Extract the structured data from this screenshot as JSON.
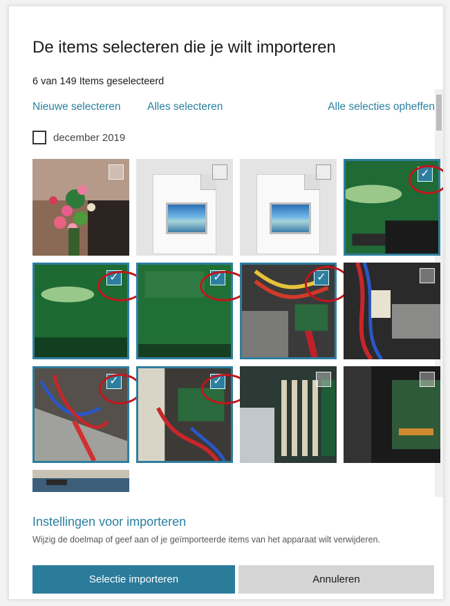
{
  "dialog": {
    "title": "De items selecteren die je wilt importeren",
    "selection_count": "6 van 149 Items geselecteerd",
    "links": {
      "select_new": "Nieuwe selecteren",
      "select_all": "Alles selecteren",
      "clear_all": "Alle selecties opheffen"
    },
    "group": {
      "label": "december 2019",
      "checked": false
    },
    "tiles": [
      {
        "kind": "photo-flowers",
        "selected": false
      },
      {
        "kind": "image-file-placeholder",
        "selected": false
      },
      {
        "kind": "image-file-placeholder",
        "selected": false
      },
      {
        "kind": "photo-circuit-board",
        "selected": true
      },
      {
        "kind": "photo-circuit-board",
        "selected": true
      },
      {
        "kind": "photo-circuit-board",
        "selected": true
      },
      {
        "kind": "photo-computer-cables",
        "selected": true
      },
      {
        "kind": "photo-computer-cables",
        "selected": false
      },
      {
        "kind": "photo-computer-interior",
        "selected": true
      },
      {
        "kind": "photo-computer-interior",
        "selected": true
      },
      {
        "kind": "photo-ram-slots",
        "selected": false
      },
      {
        "kind": "photo-computer-interior-dark",
        "selected": false
      },
      {
        "kind": "photo-circuit-board",
        "selected": false
      }
    ],
    "annotation_color": "#c0161c",
    "settings": {
      "title": "Instellingen voor importeren",
      "description": "Wijzig de doelmap of geef aan of je geïmporteerde items van het apparaat wilt verwijderen."
    },
    "buttons": {
      "import": "Selectie importeren",
      "cancel": "Annuleren"
    }
  },
  "colors": {
    "accent": "#2b7b9b",
    "link": "#2a7fa0",
    "annotation": "#c0161c"
  }
}
